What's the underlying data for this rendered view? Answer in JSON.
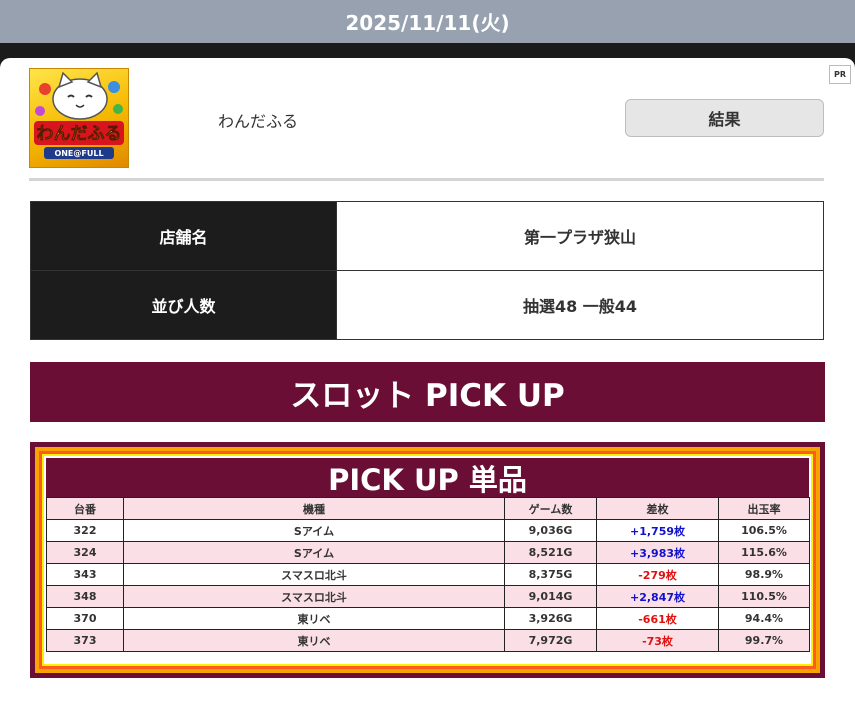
{
  "header": {
    "date": "2025/11/11(火)"
  },
  "ad": {
    "pr_label": "PR"
  },
  "app": {
    "logo_lines": [
      "わんだふる",
      "ONE@FULL"
    ],
    "name": "わんだふる",
    "result_button": "結果"
  },
  "store_info": {
    "rows": [
      {
        "label": "店舗名",
        "value": "第一プラザ狭山"
      },
      {
        "label": "並び人数",
        "value": "抽選48 一般44"
      }
    ]
  },
  "slot_section": {
    "title": "スロット PICK UP"
  },
  "pickup": {
    "title": "PICK UP 単品",
    "columns": [
      "台番",
      "機種",
      "ゲーム数",
      "差枚",
      "出玉率"
    ],
    "rows": [
      {
        "number": "322",
        "machine": "Sアイム",
        "games": "9,036G",
        "diff": "+1,759枚",
        "rate": "106.5%",
        "diff_sign": "positive"
      },
      {
        "number": "324",
        "machine": "Sアイム",
        "games": "8,521G",
        "diff": "+3,983枚",
        "rate": "115.6%",
        "diff_sign": "positive"
      },
      {
        "number": "343",
        "machine": "スマスロ北斗",
        "games": "8,375G",
        "diff": "-279枚",
        "rate": "98.9%",
        "diff_sign": "negative"
      },
      {
        "number": "348",
        "machine": "スマスロ北斗",
        "games": "9,014G",
        "diff": "+2,847枚",
        "rate": "110.5%",
        "diff_sign": "positive"
      },
      {
        "number": "370",
        "machine": "東リベ",
        "games": "3,926G",
        "diff": "-661枚",
        "rate": "94.4%",
        "diff_sign": "negative"
      },
      {
        "number": "373",
        "machine": "東リベ",
        "games": "7,972G",
        "diff": "-73枚",
        "rate": "99.7%",
        "diff_sign": "negative"
      }
    ]
  },
  "colors": {
    "header_bar": "#97a1b0",
    "accent_maroon": "#6a0e35",
    "row_pink": "#fbdfe6",
    "positive": "#1111cc",
    "negative": "#e01010"
  }
}
